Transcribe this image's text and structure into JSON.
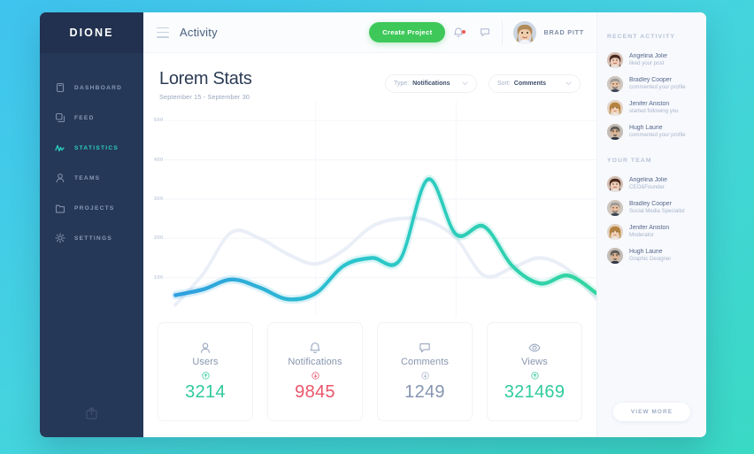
{
  "theme": {
    "page_gradient_from": "#3fc3ef",
    "page_gradient_to": "#3ad9c4",
    "sidebar_bg": "#253858",
    "accent_teal": "#2bd0c0",
    "accent_green": "#3ec85a",
    "accent_red": "#f2544f",
    "text_dark": "#2d3c55",
    "text_muted": "#98a6bd"
  },
  "sidebar": {
    "brand": "DIONE",
    "items": [
      {
        "label": "DASHBOARD",
        "icon": "clipboard-icon",
        "active": false
      },
      {
        "label": "FEED",
        "icon": "layers-icon",
        "active": false
      },
      {
        "label": "STATISTICS",
        "icon": "pulse-icon",
        "active": true
      },
      {
        "label": "TEAMS",
        "icon": "user-icon",
        "active": false
      },
      {
        "label": "PROJECTS",
        "icon": "folder-icon",
        "active": false
      },
      {
        "label": "SETTINGS",
        "icon": "gear-icon",
        "active": false
      }
    ],
    "footer_icon": "share-upload-icon"
  },
  "topbar": {
    "menu_icon": "hamburger-icon",
    "title": "Activity",
    "create_project_label": "Create Project",
    "bell_icon": "bell-icon",
    "bell_has_badge": true,
    "message_icon": "chat-bubble-icon",
    "user_name": "BRAD PITT",
    "user_avatar": "avatar-brad-pitt"
  },
  "chart_panel": {
    "title": "Lorem Stats",
    "subtitle": "September 15 - September 30",
    "filters": [
      {
        "key": "Type:",
        "value": "Notifications",
        "icon": "chevron-down-icon"
      },
      {
        "key": "Sort:",
        "value": "Comments",
        "icon": "chevron-down-icon"
      }
    ]
  },
  "chart_data": {
    "type": "line",
    "title": "Lorem Stats",
    "subtitle": "September 15 - September 30",
    "xlabel": "",
    "ylabel": "",
    "ylim": [
      0,
      550
    ],
    "yticks": [
      500,
      400,
      300,
      200,
      100
    ],
    "ytick_labels": [
      "500",
      "400",
      "300",
      "200",
      "100"
    ],
    "grid": "horizontal-faint",
    "legend": "none",
    "x": [
      0,
      1,
      2,
      3,
      4,
      5,
      6,
      7,
      8,
      9,
      10,
      11,
      12,
      13,
      14,
      15
    ],
    "series": [
      {
        "name": "primary",
        "color_start": "#2f9fe0",
        "color_mid": "#2bc6cb",
        "color_end": "#33d69f",
        "values": [
          55,
          70,
          95,
          75,
          45,
          60,
          130,
          150,
          145,
          350,
          210,
          230,
          130,
          85,
          105,
          60
        ]
      },
      {
        "name": "secondary",
        "color": "#eaeef7",
        "values": [
          30,
          110,
          215,
          200,
          160,
          135,
          170,
          230,
          250,
          245,
          200,
          105,
          125,
          150,
          120,
          45
        ]
      }
    ]
  },
  "stat_cards": [
    {
      "label": "Users",
      "value": "3214",
      "icon": "user-icon",
      "trend": "up",
      "trend_icon": "arrow-up-circle-icon",
      "color": "#2fcb9d"
    },
    {
      "label": "Notifications",
      "value": "9845",
      "icon": "bell-icon",
      "trend": "down",
      "trend_icon": "arrow-down-circle-icon",
      "color": "#e9566a"
    },
    {
      "label": "Comments",
      "value": "1249",
      "icon": "chat-bubble-icon",
      "trend": "down",
      "trend_icon": "arrow-down-circle-icon",
      "color": "#8695b2"
    },
    {
      "label": "Views",
      "value": "321469",
      "icon": "eye-icon",
      "trend": "up",
      "trend_icon": "arrow-up-circle-icon",
      "color": "#2fcb9d"
    }
  ],
  "right_panel": {
    "recent_activity_title": "RECENT ACTIVITY",
    "recent_activity": [
      {
        "name": "Angelina Jolie",
        "meta": "liked your post",
        "avatar": "avatar-angelina-jolie"
      },
      {
        "name": "Bradley Cooper",
        "meta": "commented your profile",
        "avatar": "avatar-bradley-cooper"
      },
      {
        "name": "Jenifer Aniston",
        "meta": "started following you",
        "avatar": "avatar-jenifer-aniston"
      },
      {
        "name": "Hugh Laurie",
        "meta": "commented your profile",
        "avatar": "avatar-hugh-laurie"
      }
    ],
    "your_team_title": "YOUR TEAM",
    "your_team": [
      {
        "name": "Angelina Jolie",
        "meta": "CEO&Founder",
        "avatar": "avatar-angelina-jolie"
      },
      {
        "name": "Bradley Cooper",
        "meta": "Social Media Specialist",
        "avatar": "avatar-bradley-cooper"
      },
      {
        "name": "Jenifer Aniston",
        "meta": "Moderator",
        "avatar": "avatar-jenifer-aniston"
      },
      {
        "name": "Hugh Laurie",
        "meta": "Graphic Designer",
        "avatar": "avatar-hugh-laurie"
      }
    ],
    "view_more_label": "VIEW MORE"
  }
}
